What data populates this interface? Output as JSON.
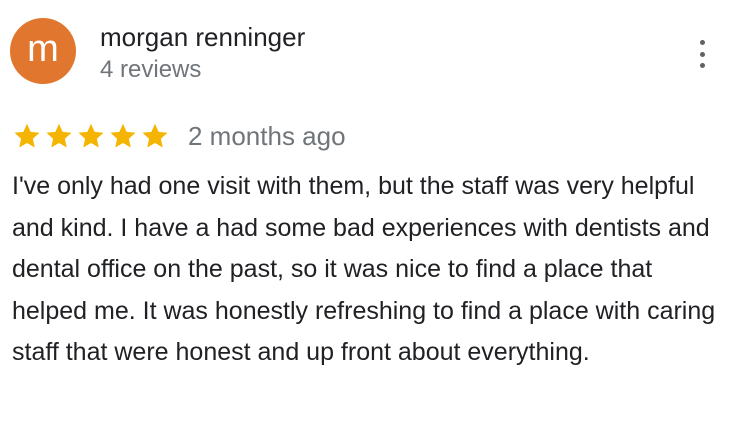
{
  "reviewer": {
    "avatar_initial": "m",
    "avatar_color": "#e1762f",
    "name": "morgan renninger",
    "review_count": "4 reviews"
  },
  "menu": {
    "icon": "more-vert-icon"
  },
  "review": {
    "rating": 5,
    "rating_max": 5,
    "star_color": "#f4b400",
    "date": "2 months ago",
    "text": "I've only had one visit with them, but the staff was very helpful and kind. I have a had some bad experiences with dentists and dental office on the past, so it was nice to find a place that helped me. It was honestly refreshing to find a place with caring staff that were honest and up front about everything."
  }
}
